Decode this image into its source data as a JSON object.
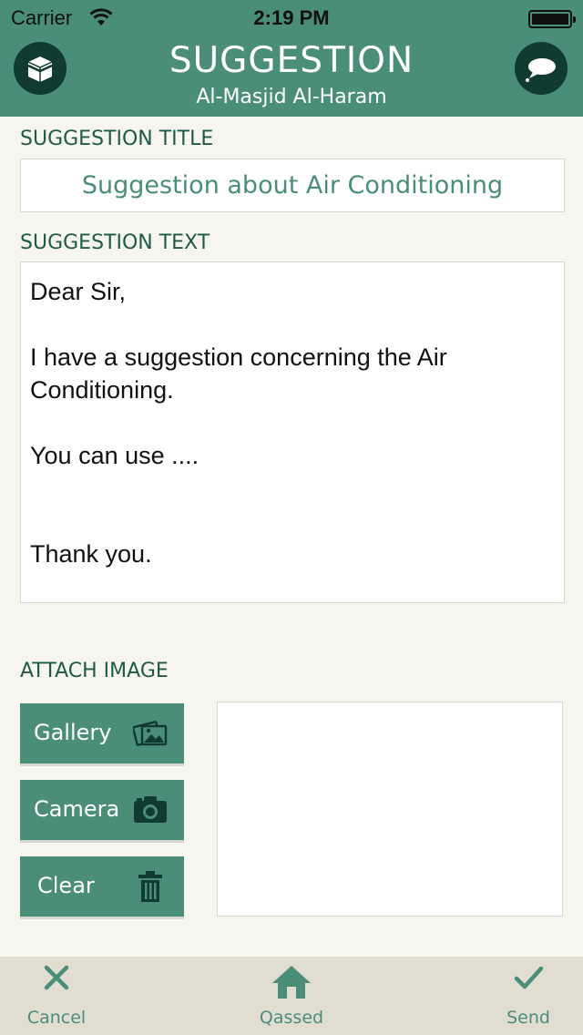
{
  "status": {
    "carrier": "Carrier",
    "time": "2:19 PM"
  },
  "header": {
    "title": "SUGGESTION",
    "subtitle": "Al-Masjid Al-Haram",
    "left_icon": "kaaba-icon",
    "right_icon": "speech-bubble-icon"
  },
  "form": {
    "title_label": "SUGGESTION TITLE",
    "title_value": "Suggestion about Air Conditioning",
    "text_label": "SUGGESTION TEXT",
    "text_value": "Dear Sir,\n\nI have a suggestion concerning the Air Conditioning.\n\nYou can use ....\n\n\nThank you.",
    "attach_label": "ATTACH IMAGE",
    "gallery_label": "Gallery",
    "camera_label": "Camera",
    "clear_label": "Clear"
  },
  "tabbar": {
    "cancel": "Cancel",
    "home": "Qassed",
    "send": "Send"
  },
  "colors": {
    "primary": "#4a8e7a",
    "dark": "#0f3b30",
    "label": "#1f5a48",
    "background": "#f6f5ee",
    "tabbar": "#e1ddd1"
  }
}
